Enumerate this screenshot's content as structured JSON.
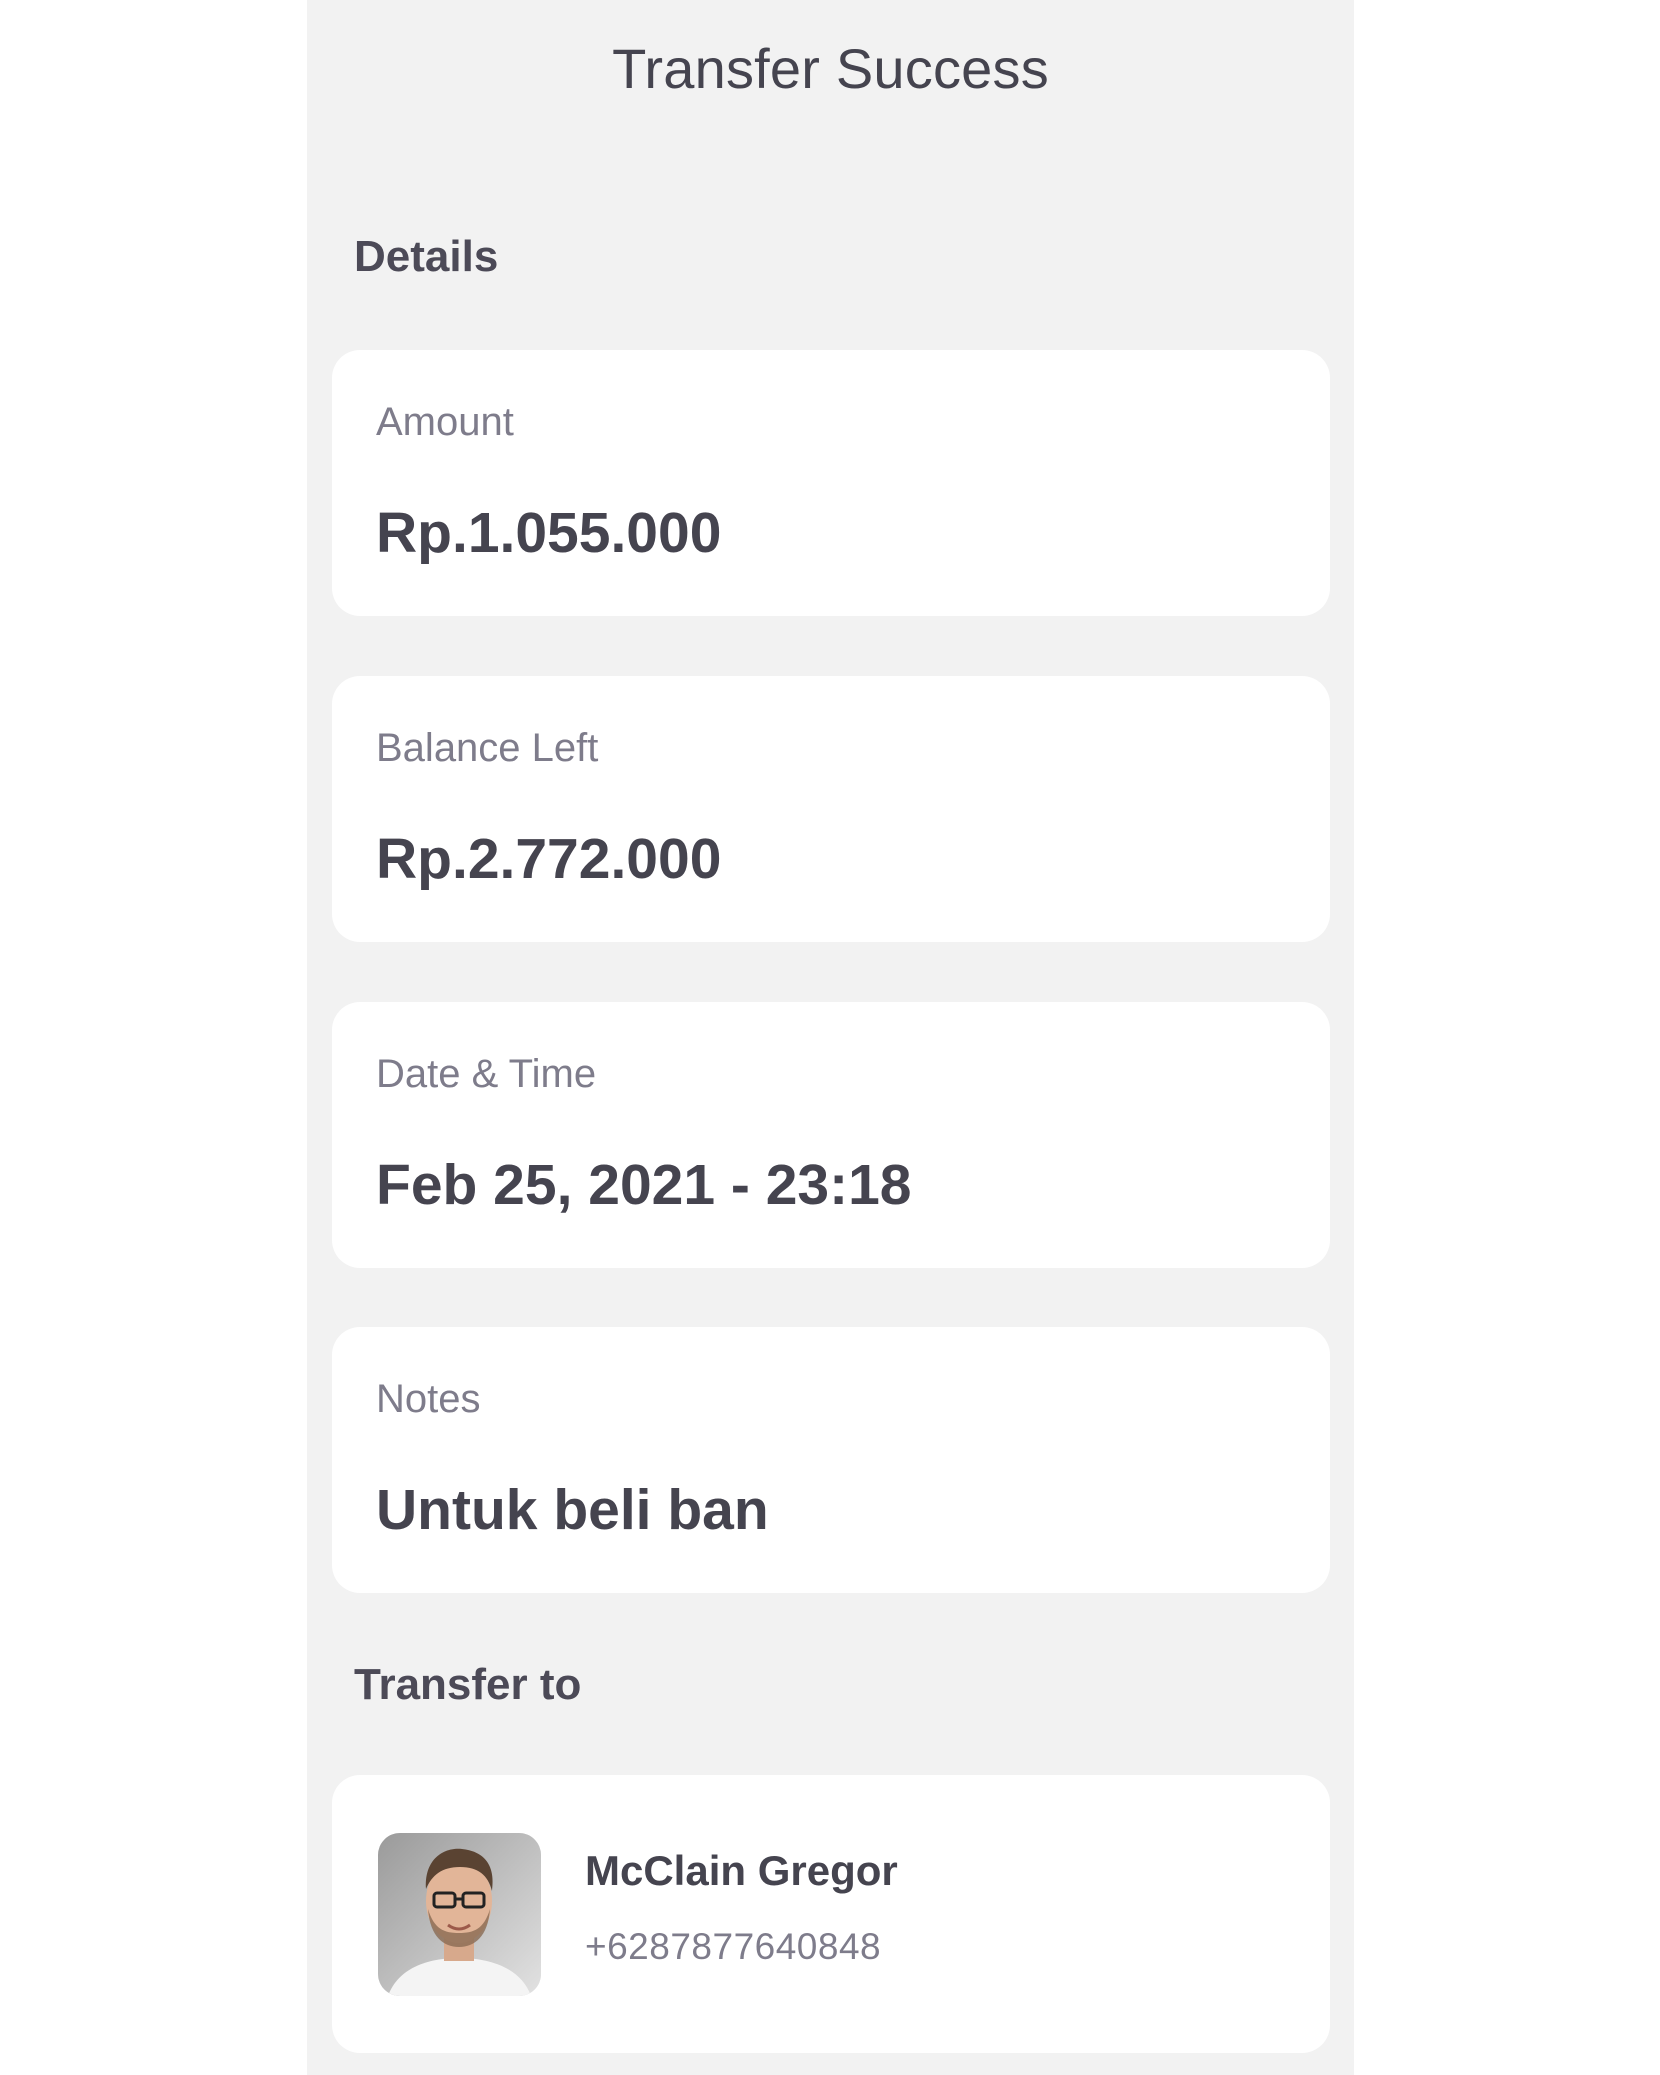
{
  "header": {
    "title": "Transfer Success"
  },
  "details": {
    "section_label": "Details",
    "amount": {
      "label": "Amount",
      "value": "Rp.1.055.000"
    },
    "balance_left": {
      "label": "Balance Left",
      "value": "Rp.2.772.000"
    },
    "date_time": {
      "label": "Date & Time",
      "value": "Feb 25, 2021 - 23:18"
    },
    "notes": {
      "label": "Notes",
      "value": "Untuk beli ban"
    }
  },
  "transfer_to": {
    "section_label": "Transfer to",
    "recipient": {
      "name": "McClain Gregor",
      "phone": "+6287877640848",
      "avatar_icon": "user-photo-avatar"
    }
  },
  "colors": {
    "panel_background": "#f2f2f2",
    "card_background": "#ffffff",
    "primary_text": "#45444f",
    "secondary_text": "#7e7c8b"
  }
}
